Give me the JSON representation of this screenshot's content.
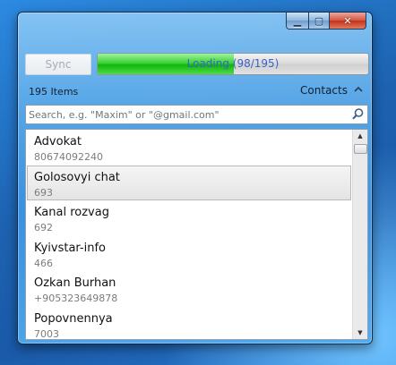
{
  "window": {
    "caption": {
      "minimize": "▁",
      "maximize": "▢",
      "close": "✕"
    }
  },
  "toolbar": {
    "sync_label": "Sync",
    "progress_text": "Loading (98/195)",
    "progress_fraction": 0.502
  },
  "status": {
    "items_count": "195 Items",
    "contacts_label": "Contacts"
  },
  "search": {
    "placeholder": "Search, e.g. \"Maxim\" or \"@gmail.com\"",
    "value": ""
  },
  "contacts": [
    {
      "name": "Advokat",
      "detail": "80674092240",
      "selected": false
    },
    {
      "name": "Golosovyi chat",
      "detail": "693",
      "selected": true
    },
    {
      "name": "Kanal rozvag",
      "detail": "692",
      "selected": false
    },
    {
      "name": "Kyivstar-info",
      "detail": "466",
      "selected": false
    },
    {
      "name": "Ozkan Burhan",
      "detail": "+905323649878",
      "selected": false
    },
    {
      "name": "Popovnennya",
      "detail": "7003",
      "selected": false
    }
  ],
  "colors": {
    "progress_green": "#10b70c",
    "progress_text": "#3a62c9"
  }
}
